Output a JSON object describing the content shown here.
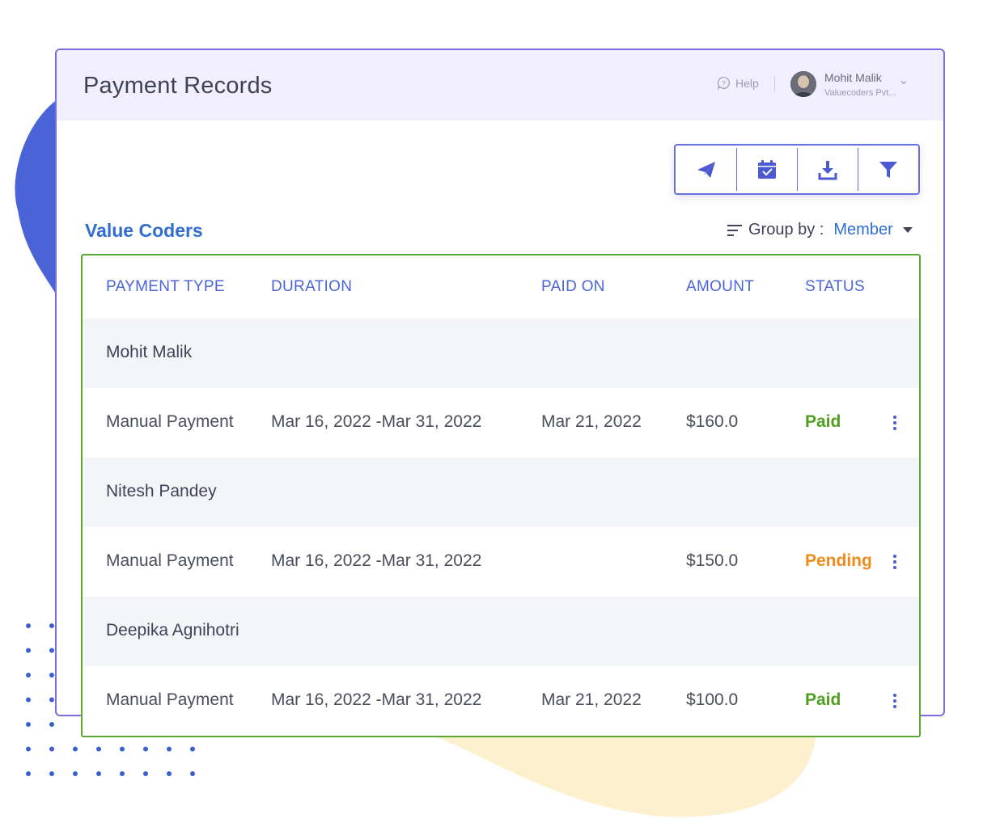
{
  "header": {
    "title": "Payment Records",
    "help_label": "Help",
    "user": {
      "name": "Mohit Malik",
      "org": "Valuecoders Pvt..."
    }
  },
  "toolbar": {
    "buttons": [
      {
        "icon": "send-icon"
      },
      {
        "icon": "calendar-check-icon"
      },
      {
        "icon": "download-icon"
      },
      {
        "icon": "filter-icon"
      }
    ]
  },
  "org_title": "Value Coders",
  "group_by": {
    "label": "Group by :",
    "value": "Member"
  },
  "table": {
    "columns": [
      "PAYMENT TYPE",
      "DURATION",
      "PAID ON",
      "AMOUNT",
      "STATUS"
    ],
    "groups": [
      {
        "member": "Mohit Malik",
        "rows": [
          {
            "type": "Manual Payment",
            "duration": "Mar 16, 2022 -Mar 31, 2022",
            "paid_on": "Mar 21, 2022",
            "amount": "$160.0",
            "status": "Paid"
          }
        ]
      },
      {
        "member": "Nitesh Pandey",
        "rows": [
          {
            "type": "Manual Payment",
            "duration": "Mar 16, 2022 -Mar 31, 2022",
            "paid_on": "",
            "amount": "$150.0",
            "status": "Pending"
          }
        ]
      },
      {
        "member": "Deepika Agnihotri",
        "rows": [
          {
            "type": "Manual Payment",
            "duration": "Mar 16, 2022 -Mar 31, 2022",
            "paid_on": "Mar 21, 2022",
            "amount": "$100.0",
            "status": "Paid"
          }
        ]
      }
    ]
  },
  "colors": {
    "accent": "#4b64d8",
    "brand_blue": "#2f6ed0",
    "table_border": "#58a832",
    "status_paid": "#4f9e1f",
    "status_pending": "#ef8a1c"
  }
}
